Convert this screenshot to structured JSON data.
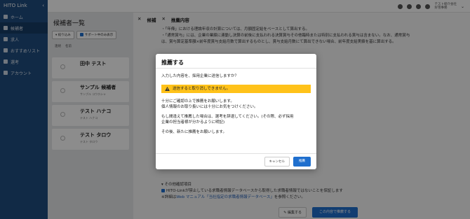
{
  "app": {
    "logo": "HITO Link"
  },
  "sidebar": {
    "items": [
      {
        "label": "ホーム"
      },
      {
        "label": "候補者"
      },
      {
        "label": "求人"
      },
      {
        "label": "おすすめリスト"
      },
      {
        "label": "選考"
      },
      {
        "label": "アカウント"
      }
    ]
  },
  "topbar": {
    "user_line1": "テスト紹介会社",
    "user_line2": "好雪事務"
  },
  "list": {
    "title": "候補者一覧",
    "filter_btn": "絞り込み",
    "show_btn": "サポート中のみ表示",
    "col_status": "連絡",
    "col_name": "名前",
    "candidates": [
      {
        "name": "田中 テスト",
        "kana": ""
      },
      {
        "name": "サンプル 候補者",
        "kana": "サンプル コウホシャ"
      },
      {
        "name": "テスト ハナコ",
        "kana": "テスト ハナコ"
      },
      {
        "name": "テスト タロウ",
        "kana": "テスト タロウ"
      }
    ]
  },
  "detail": {
    "tab1": "候補",
    "tab2": "推薦内容",
    "text_lines": [
      "・「年俸」における理論年収の計算については、月額固定給をベースとして算出する。",
      "・「通常賞与」には、企業の業績に連動し決算の前後に支払われる決算賞与その他臨時または特別に支払われる賞与は含まない。なお、通常賞与",
      "は、賞与算定基準額×前年度賞与支給月数で算出するものとし、賞与支給月数にて算出できない場合、前年度支給実績を基に算出する。"
    ],
    "section_other": "▾ その他確認項目",
    "check_label": "HITO-Linkが禁止している求職者情報データベースから取得した求職者情報ではないことを保証します",
    "note": "※詳細は",
    "note_link": "Web マニュアル「当社指定の求職者情報データベース」",
    "note_end": "を参照ください。",
    "edit_btn": "✎ 編集する",
    "recommend_btn": "この内容で推薦する"
  },
  "modal": {
    "title": "推薦する",
    "question": "入力した内容を、採用企業に送信しますか？",
    "warning": "送信すると取り消しできません。",
    "p1_line1": "十分にご確認の上で推薦をお願いします。",
    "p1_line2": "個人情報のお取り扱いには十分にお気をつけください。",
    "p2_line1": "もし間違えて推薦した場合は、選考を辞退してください。(その際、必ず採用",
    "p2_line2": "企業の担当者様が分かるように明記)",
    "p3": "その後、新たに推薦をお願いします。",
    "cancel": "キャンセル",
    "submit": "推薦"
  },
  "colors": {
    "sidebar": "#1f4d80",
    "primary": "#1f6fce",
    "warning": "#ffc21a"
  }
}
